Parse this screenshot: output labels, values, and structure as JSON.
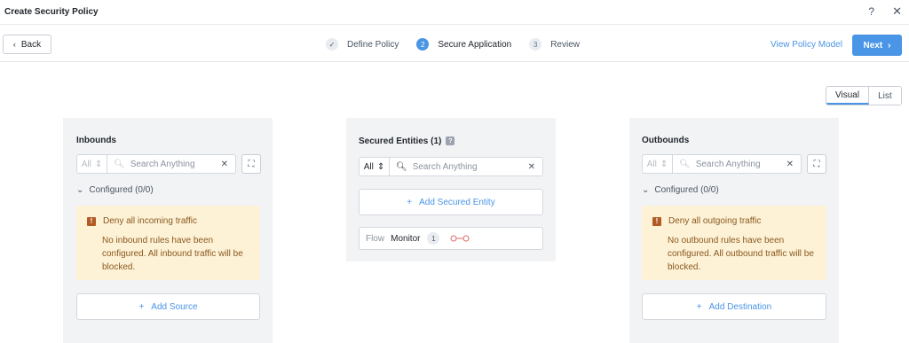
{
  "header": {
    "title": "Create Security Policy",
    "help": "?",
    "close": "✕"
  },
  "nav": {
    "back_label": "Back",
    "steps": [
      {
        "num": "✓",
        "label": "Define Policy",
        "state": "done"
      },
      {
        "num": "2",
        "label": "Secure Application",
        "state": "active"
      },
      {
        "num": "3",
        "label": "Review",
        "state": "pending"
      }
    ],
    "view_policy_model": "View Policy Model",
    "next_label": "Next"
  },
  "view_toggle": {
    "visual": "Visual",
    "list": "List",
    "selected": "Visual"
  },
  "inbounds": {
    "heading": "Inbounds",
    "filter": "All",
    "search_placeholder": "Search Anything",
    "configured": "Configured (0/0)",
    "warning_title": "Deny all incoming traffic",
    "warning_body": "No inbound rules have been configured. All inbound traffic will be blocked.",
    "add_label": "Add Source"
  },
  "secured": {
    "heading": "Secured Entities (1)",
    "filter": "All",
    "search_placeholder": "Search Anything",
    "add_label": "Add Secured Entity",
    "flow_label": "Flow",
    "flow_mode": "Monitor",
    "flow_count": "1"
  },
  "outbounds": {
    "heading": "Outbounds",
    "filter": "All",
    "search_placeholder": "Search Anything",
    "configured": "Configured (0/0)",
    "warning_title": "Deny all outgoing traffic",
    "warning_body": "No outbound rules have been configured. All outbound traffic will be blocked.",
    "add_label": "Add Destination"
  },
  "colors": {
    "accent": "#4a95e5",
    "warning_bg": "#fdf1d6",
    "warning_text": "#8a5a1f",
    "panel_bg": "#f2f3f5"
  }
}
